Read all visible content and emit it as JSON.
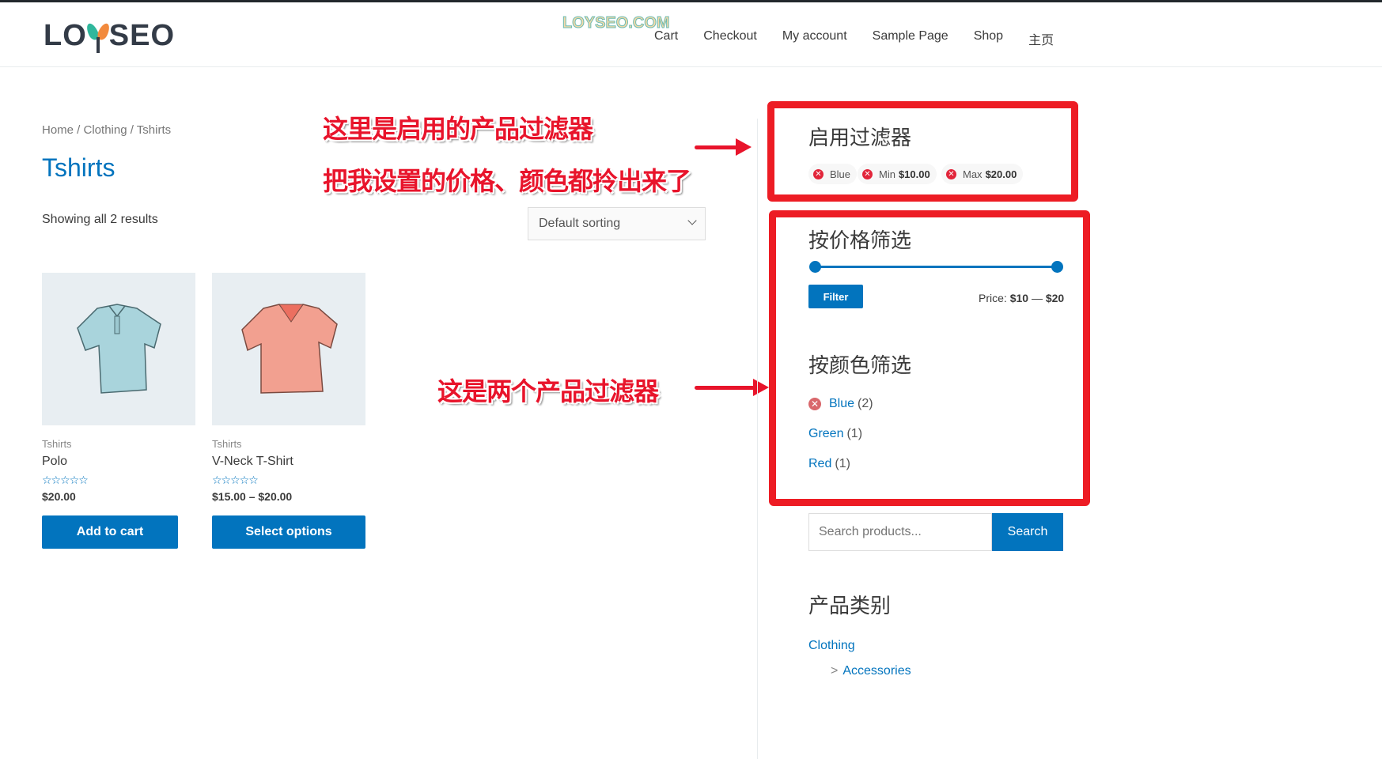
{
  "header": {
    "logo_text_left": "LO",
    "logo_text_right": "SEO",
    "watermark": "LOYSEO.COM",
    "nav": [
      "Cart",
      "Checkout",
      "My account",
      "Sample Page",
      "Shop",
      "主页"
    ]
  },
  "main": {
    "breadcrumb": "Home / Clothing / Tshirts",
    "title": "Tshirts",
    "result_count": "Showing all 2 results",
    "sorting": "Default sorting",
    "products": [
      {
        "category": "Tshirts",
        "name": "Polo",
        "stars": "☆☆☆☆☆",
        "rating": 0,
        "price": "$20.00",
        "button": "Add to cart",
        "image": "blue-polo-shirt"
      },
      {
        "category": "Tshirts",
        "name": "V-Neck T-Shirt",
        "stars": "☆☆☆☆☆",
        "rating": 0,
        "price": "$15.00 – $20.00",
        "button": "Select options",
        "image": "red-vneck-tshirt"
      }
    ]
  },
  "annotations": {
    "line1": "这里是启用的产品过滤器",
    "line2": "把我设置的价格、颜色都拎出来了",
    "line3": "这是两个产品过滤器"
  },
  "sidebar": {
    "active_filters": {
      "title": "启用过滤器",
      "chips": [
        {
          "label": "Blue",
          "value": ""
        },
        {
          "label": "Min",
          "value": "$10.00"
        },
        {
          "label": "Max",
          "value": "$20.00"
        }
      ]
    },
    "price_filter": {
      "title": "按价格筛选",
      "button": "Filter",
      "price_prefix": "Price:",
      "min": "$10",
      "separator": "—",
      "max": "$20",
      "range_min_fraction": 0,
      "range_max_fraction": 1
    },
    "color_filter": {
      "title": "按颜色筛选",
      "items": [
        {
          "label": "Blue",
          "count": "(2)",
          "active": true
        },
        {
          "label": "Green",
          "count": "(1)",
          "active": false
        },
        {
          "label": "Red",
          "count": "(1)",
          "active": false
        }
      ]
    },
    "search": {
      "placeholder": "Search products...",
      "button": "Search"
    },
    "categories": {
      "title": "产品类别",
      "items": [
        {
          "label": "Clothing",
          "child": false
        },
        {
          "label": "Accessories",
          "child": true
        }
      ]
    }
  },
  "colors": {
    "accent": "#0274be",
    "annotation_red": "#ed1c24"
  }
}
